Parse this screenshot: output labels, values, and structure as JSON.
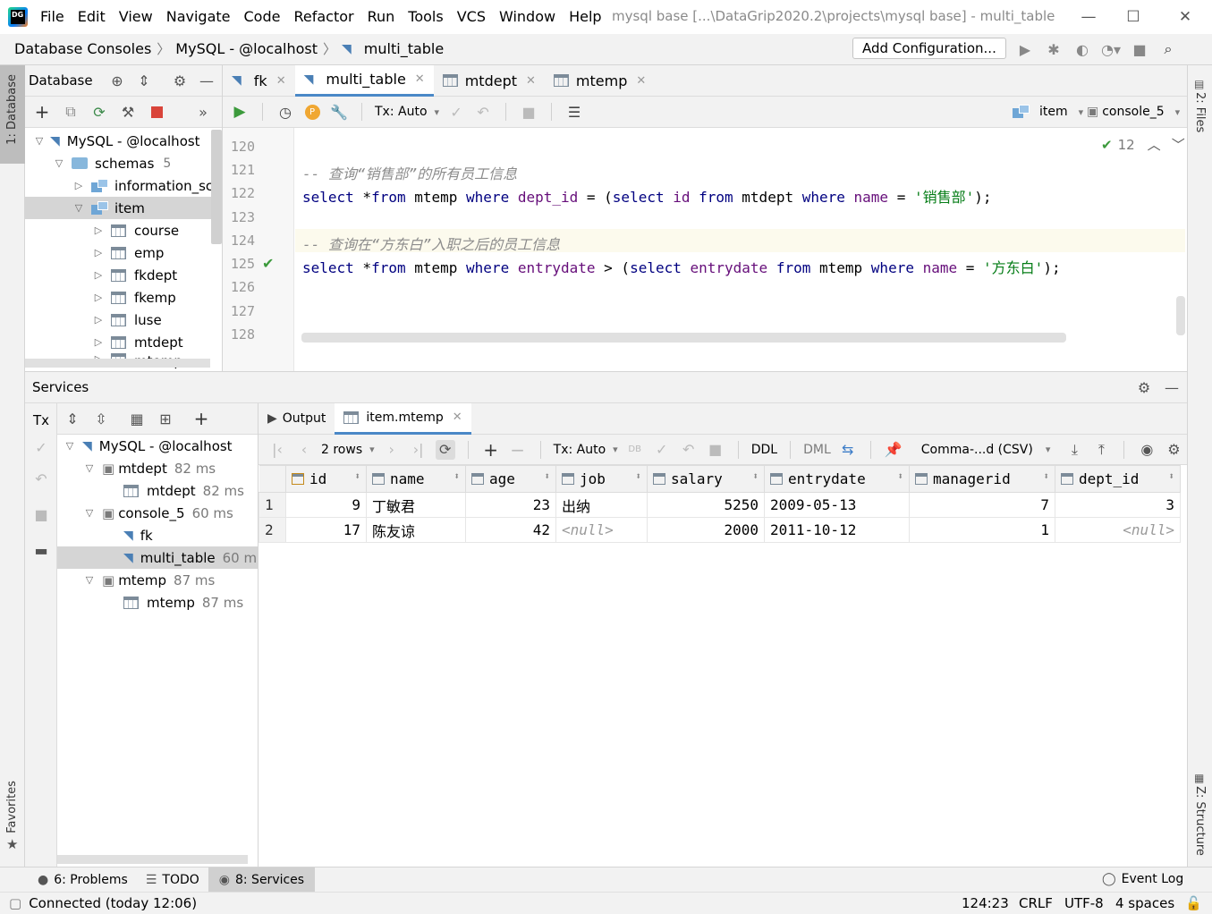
{
  "titlebar": {
    "menu": [
      "File",
      "Edit",
      "View",
      "Navigate",
      "Code",
      "Refactor",
      "Run",
      "Tools",
      "VCS",
      "Window",
      "Help"
    ],
    "title": "mysql base [...\\DataGrip2020.2\\projects\\mysql base] - multi_table"
  },
  "navbar": {
    "crumbs": [
      "Database Consoles",
      "MySQL - @localhost",
      "multi_table"
    ],
    "add_config": "Add Configuration..."
  },
  "left_strip": {
    "database": "1: Database",
    "favorites": "Favorites"
  },
  "right_strip": {
    "files": "2: Files",
    "structure": "Z: Structure"
  },
  "dbpanel": {
    "title": "Database",
    "tree": [
      {
        "label": "MySQL - @localhost",
        "extra": ""
      },
      {
        "label": "schemas",
        "extra": "5"
      },
      {
        "label": "information_sch",
        "extra": ""
      },
      {
        "label": "item",
        "extra": ""
      },
      {
        "label": "course"
      },
      {
        "label": "emp"
      },
      {
        "label": "fkdept"
      },
      {
        "label": "fkemp"
      },
      {
        "label": "luse"
      },
      {
        "label": "mtdept"
      },
      {
        "label": "mtemp"
      }
    ]
  },
  "editor": {
    "tabs": [
      "fk",
      "multi_table",
      "mtdept",
      "mtemp"
    ],
    "tx": "Tx: Auto",
    "schema": "item",
    "console": "console_5",
    "checks": "12",
    "lines": [
      "120",
      "121",
      "122",
      "123",
      "124",
      "125",
      "126",
      "127",
      "128"
    ],
    "code": {
      "c121": "-- 查询“销售部”的所有员工信息",
      "l122": {
        "a": "select",
        "b": " *",
        "c": "from",
        "d": " mtemp ",
        "e": "where",
        "f": " dept_id",
        "g": " = (",
        "h": "select",
        "i": " id ",
        "j": "from",
        "k": " mtdept ",
        "l": "where",
        "m": " name",
        "n": " = ",
        "o": "'销售部'",
        "p": ");"
      },
      "c124": "-- 查询在“方东白”入职之后的员工信息",
      "l125": {
        "a": "select",
        "b": " *",
        "c": "from",
        "d": " mtemp ",
        "e": "where",
        "f": " entrydate",
        "g": " > (",
        "h": "select",
        "i": " entrydate ",
        "j": "from",
        "k": " mtemp ",
        "l": "where",
        "m": " name",
        "n": " = ",
        "o": "'方东白'",
        "p": ");"
      }
    }
  },
  "services": {
    "title": "Services",
    "tx_label": "Tx",
    "tree": [
      {
        "label": "MySQL - @localhost",
        "ms": ""
      },
      {
        "label": "mtdept",
        "ms": "82 ms"
      },
      {
        "label": "mtdept",
        "ms": "82 ms"
      },
      {
        "label": "console_5",
        "ms": "60 ms"
      },
      {
        "label": "fk",
        "ms": ""
      },
      {
        "label": "multi_table",
        "ms": "60 m"
      },
      {
        "label": "mtemp",
        "ms": "87 ms"
      },
      {
        "label": "mtemp",
        "ms": "87 ms"
      }
    ],
    "tabs": [
      "Output",
      "item.mtemp"
    ],
    "rows_label": "2 rows",
    "tx": "Tx: Auto",
    "ddl": "DDL",
    "dml": "DML",
    "export": "Comma-...d (CSV)",
    "columns": [
      "id",
      "name",
      "age",
      "job",
      "salary",
      "entrydate",
      "managerid",
      "dept_id"
    ],
    "rows": [
      {
        "n": "1",
        "id": "9",
        "name": "丁敏君",
        "age": "23",
        "job": "出纳",
        "salary": "5250",
        "entrydate": "2009-05-13",
        "managerid": "7",
        "dept_id": "3"
      },
      {
        "n": "2",
        "id": "17",
        "name": "陈友谅",
        "age": "42",
        "job": "<null>",
        "salary": "2000",
        "entrydate": "2011-10-12",
        "managerid": "1",
        "dept_id": "<null>"
      }
    ]
  },
  "bottombar": {
    "problems": "6: Problems",
    "todo": "TODO",
    "services": "8: Services",
    "eventlog": "Event Log"
  },
  "statusbar": {
    "message": "Connected (today 12:06)",
    "position": "124:23",
    "eol": "CRLF",
    "encoding": "UTF-8",
    "indent": "4 spaces"
  }
}
